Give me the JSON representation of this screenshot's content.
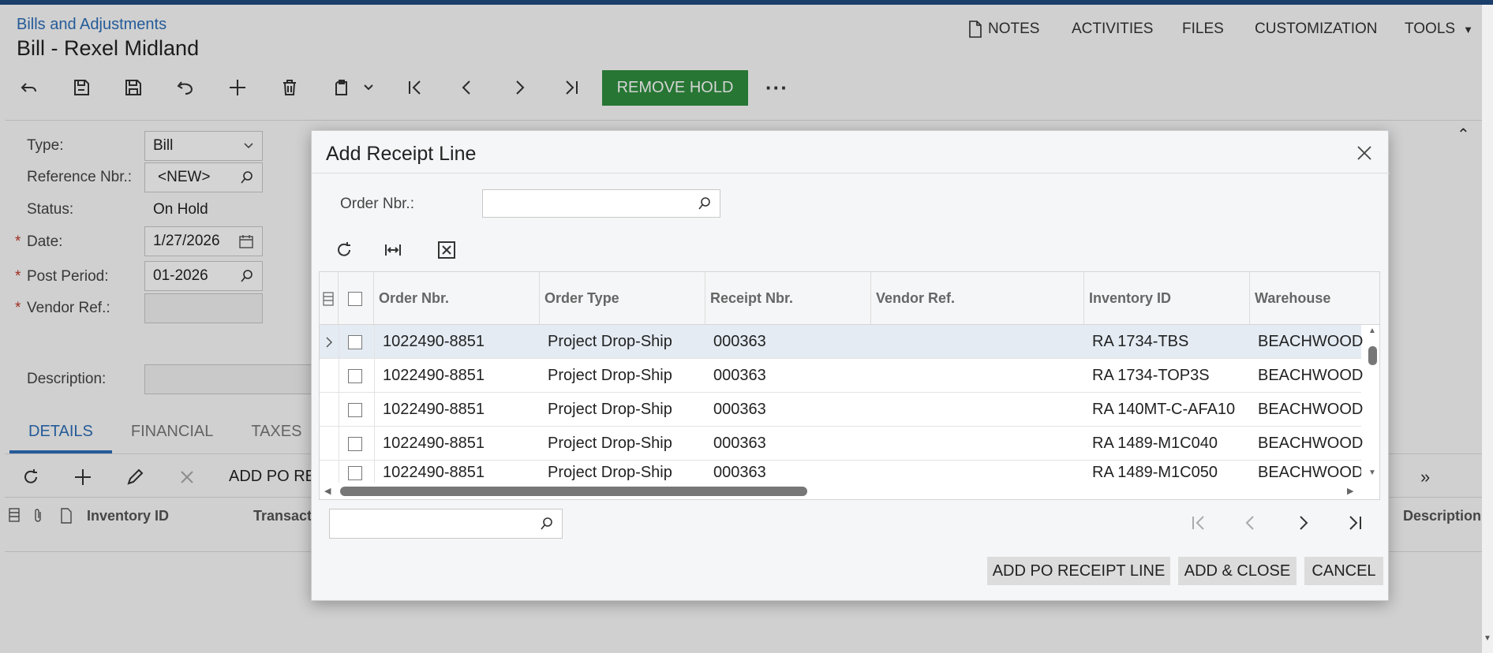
{
  "page": {
    "breadcrumb": "Bills and Adjustments",
    "title": "Bill - Rexel Midland"
  },
  "topnav": {
    "notes": "NOTES",
    "activities": "ACTIVITIES",
    "files": "FILES",
    "customization": "CUSTOMIZATION",
    "tools": "TOOLS"
  },
  "toolbar": {
    "remove_hold": "REMOVE HOLD",
    "more": "···"
  },
  "form": {
    "type_label": "Type:",
    "type_value": "Bill",
    "refnbr_label": "Reference Nbr.:",
    "refnbr_value": "<NEW>",
    "status_label": "Status:",
    "status_value": "On Hold",
    "date_label": "Date:",
    "date_value": "1/27/2026",
    "post_period_label": "Post Period:",
    "post_period_value": "01-2026",
    "vendor_ref_label": "Vendor Ref.:",
    "vendor_ref_value": "",
    "description_label": "Description:",
    "description_value": "",
    "required_mark": "*"
  },
  "tabs": {
    "details": "DETAILS",
    "financial": "FINANCIAL",
    "taxes": "TAXES"
  },
  "details_toolbar": {
    "add_po_receipt": "ADD PO RE"
  },
  "details_grid": {
    "col_inventory": "Inventory ID",
    "col_transaction": "Transact",
    "col_description": "Description"
  },
  "dialog": {
    "title": "Add Receipt Line",
    "order_nbr_label": "Order Nbr.:",
    "order_nbr_value": "",
    "columns": [
      "Order Nbr.",
      "Order Type",
      "Receipt Nbr.",
      "Vendor Ref.",
      "Inventory ID",
      "Warehouse"
    ],
    "rows": [
      {
        "order_nbr": "1022490-8851",
        "order_type": "Project Drop-Ship",
        "receipt_nbr": "000363",
        "vendor_ref": "",
        "inventory_id": "RA 1734-TBS",
        "warehouse": "BEACHWOOD"
      },
      {
        "order_nbr": "1022490-8851",
        "order_type": "Project Drop-Ship",
        "receipt_nbr": "000363",
        "vendor_ref": "",
        "inventory_id": "RA 1734-TOP3S",
        "warehouse": "BEACHWOOD"
      },
      {
        "order_nbr": "1022490-8851",
        "order_type": "Project Drop-Ship",
        "receipt_nbr": "000363",
        "vendor_ref": "",
        "inventory_id": "RA 140MT-C-AFA10",
        "warehouse": "BEACHWOOD"
      },
      {
        "order_nbr": "1022490-8851",
        "order_type": "Project Drop-Ship",
        "receipt_nbr": "000363",
        "vendor_ref": "",
        "inventory_id": "RA 1489-M1C040",
        "warehouse": "BEACHWOOD"
      },
      {
        "order_nbr": "1022490-8851",
        "order_type": "Project Drop-Ship",
        "receipt_nbr": "000363",
        "vendor_ref": "",
        "inventory_id": "RA 1489-M1C050",
        "warehouse": "BEACHWOOD"
      }
    ],
    "search_value": "",
    "add_po_receipt_line": "ADD PO RECEIPT LINE",
    "add_close": "ADD & CLOSE",
    "cancel": "CANCEL"
  }
}
